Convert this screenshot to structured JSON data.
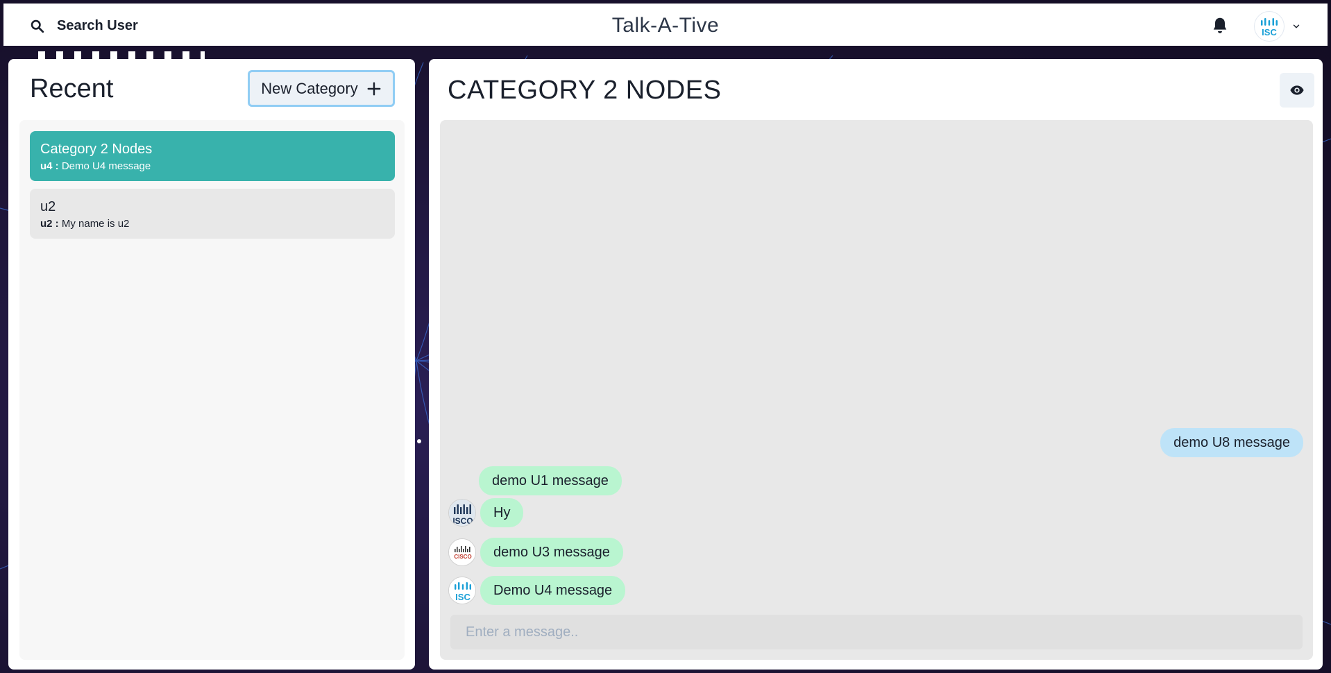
{
  "header": {
    "search_label": "Search User",
    "app_title": "Talk-A-Tive",
    "icons": {
      "search": "search-icon",
      "notifications": "bell-icon",
      "profile_avatar": "cisco-logo-avatar",
      "dropdown": "chevron-down-icon"
    }
  },
  "sidebar": {
    "title": "Recent",
    "new_category_label": "New Category",
    "chats": [
      {
        "name": "Category 2 Nodes",
        "latest_sender": "u4 :",
        "latest_text": "Demo U4 message",
        "active": true
      },
      {
        "name": "u2",
        "latest_sender": "u2 :",
        "latest_text": "My name is u2",
        "active": false
      }
    ]
  },
  "chat": {
    "title": "CATEGORY 2 NODES",
    "view_icon": "eye-icon",
    "messages": [
      {
        "text": "demo U8 message",
        "direction": "outgoing",
        "avatar": null
      },
      {
        "text": "demo U1 message",
        "direction": "incoming",
        "avatar": null
      },
      {
        "text": "Hy",
        "direction": "incoming",
        "avatar": "cisco-logo-dark"
      },
      {
        "text": "demo U3 message",
        "direction": "incoming",
        "avatar": "cisco-logo-red"
      },
      {
        "text": "Demo U4 message",
        "direction": "incoming",
        "avatar": "cisco-logo-blue"
      }
    ],
    "input_placeholder": "Enter a message.."
  },
  "colors": {
    "active_chat": "#38b2ac",
    "incoming_bubble": "#b9f5d0",
    "outgoing_bubble": "#bee3f8",
    "new_category_border": "#90cdf4"
  }
}
